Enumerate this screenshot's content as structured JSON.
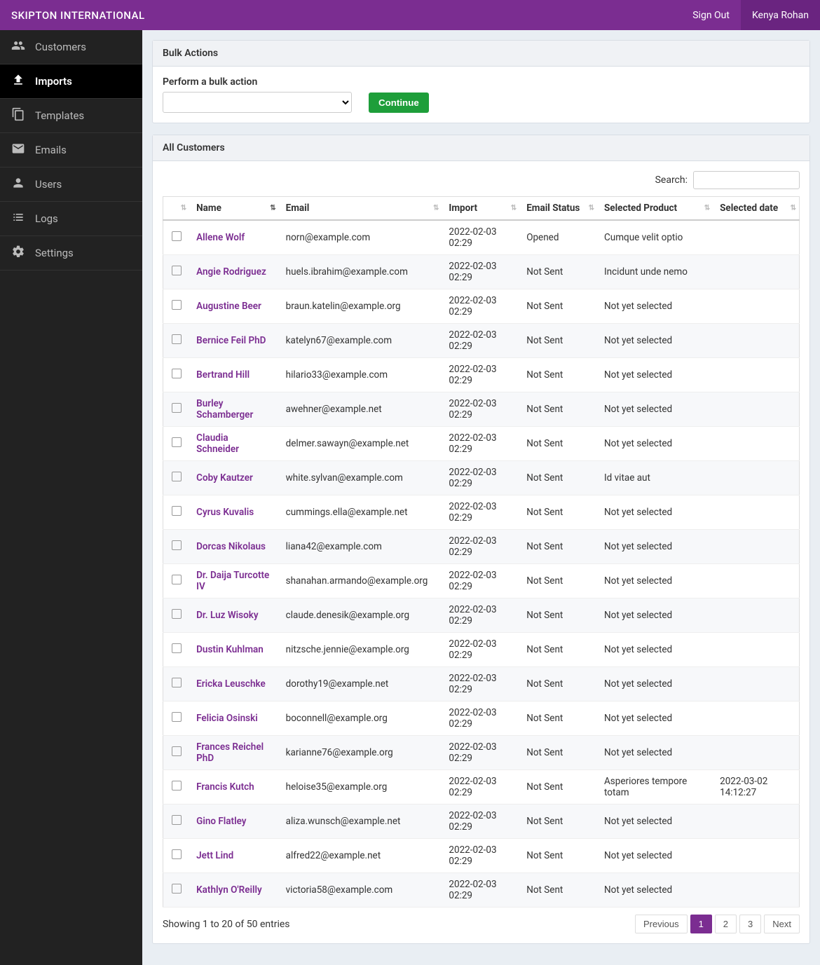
{
  "brand": "SKIPTON INTERNATIONAL",
  "topbar": {
    "signout": "Sign Out",
    "user": "Kenya Rohan"
  },
  "sidebar": {
    "items": [
      {
        "label": "Customers",
        "icon": "group"
      },
      {
        "label": "Imports",
        "icon": "upload"
      },
      {
        "label": "Templates",
        "icon": "copy"
      },
      {
        "label": "Emails",
        "icon": "envelope"
      },
      {
        "label": "Users",
        "icon": "user"
      },
      {
        "label": "Logs",
        "icon": "list"
      },
      {
        "label": "Settings",
        "icon": "gear"
      }
    ],
    "active_index": 1
  },
  "bulk": {
    "panel_title": "Bulk Actions",
    "label": "Perform a bulk action",
    "button": "Continue"
  },
  "customers_panel_title": "All Customers",
  "search": {
    "label": "Search:",
    "value": ""
  },
  "table": {
    "headers": [
      "",
      "Name",
      "Email",
      "Import",
      "Email Status",
      "Selected Product",
      "Selected date"
    ],
    "sorted_col_index": 1,
    "rows": [
      {
        "name": "Allene Wolf",
        "email": "norn@example.com",
        "import": "2022-02-03 02:29",
        "status": "Opened",
        "product": "Cumque velit optio",
        "date": ""
      },
      {
        "name": "Angie Rodriguez",
        "email": "huels.ibrahim@example.com",
        "import": "2022-02-03 02:29",
        "status": "Not Sent",
        "product": "Incidunt unde nemo",
        "date": ""
      },
      {
        "name": "Augustine Beer",
        "email": "braun.katelin@example.org",
        "import": "2022-02-03 02:29",
        "status": "Not Sent",
        "product": "Not yet selected",
        "date": ""
      },
      {
        "name": "Bernice Feil PhD",
        "email": "katelyn67@example.com",
        "import": "2022-02-03 02:29",
        "status": "Not Sent",
        "product": "Not yet selected",
        "date": ""
      },
      {
        "name": "Bertrand Hill",
        "email": "hilario33@example.com",
        "import": "2022-02-03 02:29",
        "status": "Not Sent",
        "product": "Not yet selected",
        "date": ""
      },
      {
        "name": "Burley Schamberger",
        "email": "awehner@example.net",
        "import": "2022-02-03 02:29",
        "status": "Not Sent",
        "product": "Not yet selected",
        "date": ""
      },
      {
        "name": "Claudia Schneider",
        "email": "delmer.sawayn@example.net",
        "import": "2022-02-03 02:29",
        "status": "Not Sent",
        "product": "Not yet selected",
        "date": ""
      },
      {
        "name": "Coby Kautzer",
        "email": "white.sylvan@example.com",
        "import": "2022-02-03 02:29",
        "status": "Not Sent",
        "product": "Id vitae aut",
        "date": ""
      },
      {
        "name": "Cyrus Kuvalis",
        "email": "cummings.ella@example.net",
        "import": "2022-02-03 02:29",
        "status": "Not Sent",
        "product": "Not yet selected",
        "date": ""
      },
      {
        "name": "Dorcas Nikolaus",
        "email": "liana42@example.com",
        "import": "2022-02-03 02:29",
        "status": "Not Sent",
        "product": "Not yet selected",
        "date": ""
      },
      {
        "name": "Dr. Daija Turcotte IV",
        "email": "shanahan.armando@example.org",
        "import": "2022-02-03 02:29",
        "status": "Not Sent",
        "product": "Not yet selected",
        "date": ""
      },
      {
        "name": "Dr. Luz Wisoky",
        "email": "claude.denesik@example.org",
        "import": "2022-02-03 02:29",
        "status": "Not Sent",
        "product": "Not yet selected",
        "date": ""
      },
      {
        "name": "Dustin Kuhlman",
        "email": "nitzsche.jennie@example.org",
        "import": "2022-02-03 02:29",
        "status": "Not Sent",
        "product": "Not yet selected",
        "date": ""
      },
      {
        "name": "Ericka Leuschke",
        "email": "dorothy19@example.net",
        "import": "2022-02-03 02:29",
        "status": "Not Sent",
        "product": "Not yet selected",
        "date": ""
      },
      {
        "name": "Felicia Osinski",
        "email": "boconnell@example.org",
        "import": "2022-02-03 02:29",
        "status": "Not Sent",
        "product": "Not yet selected",
        "date": ""
      },
      {
        "name": "Frances Reichel PhD",
        "email": "karianne76@example.org",
        "import": "2022-02-03 02:29",
        "status": "Not Sent",
        "product": "Not yet selected",
        "date": ""
      },
      {
        "name": "Francis Kutch",
        "email": "heloise35@example.org",
        "import": "2022-02-03 02:29",
        "status": "Not Sent",
        "product": "Asperiores tempore totam",
        "date": "2022-03-02 14:12:27"
      },
      {
        "name": "Gino Flatley",
        "email": "aliza.wunsch@example.net",
        "import": "2022-02-03 02:29",
        "status": "Not Sent",
        "product": "Not yet selected",
        "date": ""
      },
      {
        "name": "Jett Lind",
        "email": "alfred22@example.net",
        "import": "2022-02-03 02:29",
        "status": "Not Sent",
        "product": "Not yet selected",
        "date": ""
      },
      {
        "name": "Kathlyn O'Reilly",
        "email": "victoria58@example.com",
        "import": "2022-02-03 02:29",
        "status": "Not Sent",
        "product": "Not yet selected",
        "date": ""
      }
    ]
  },
  "footer": {
    "info": "Showing 1 to 20 of 50 entries",
    "prev": "Previous",
    "next": "Next",
    "pages": [
      "1",
      "2",
      "3"
    ],
    "active_page": "1"
  }
}
